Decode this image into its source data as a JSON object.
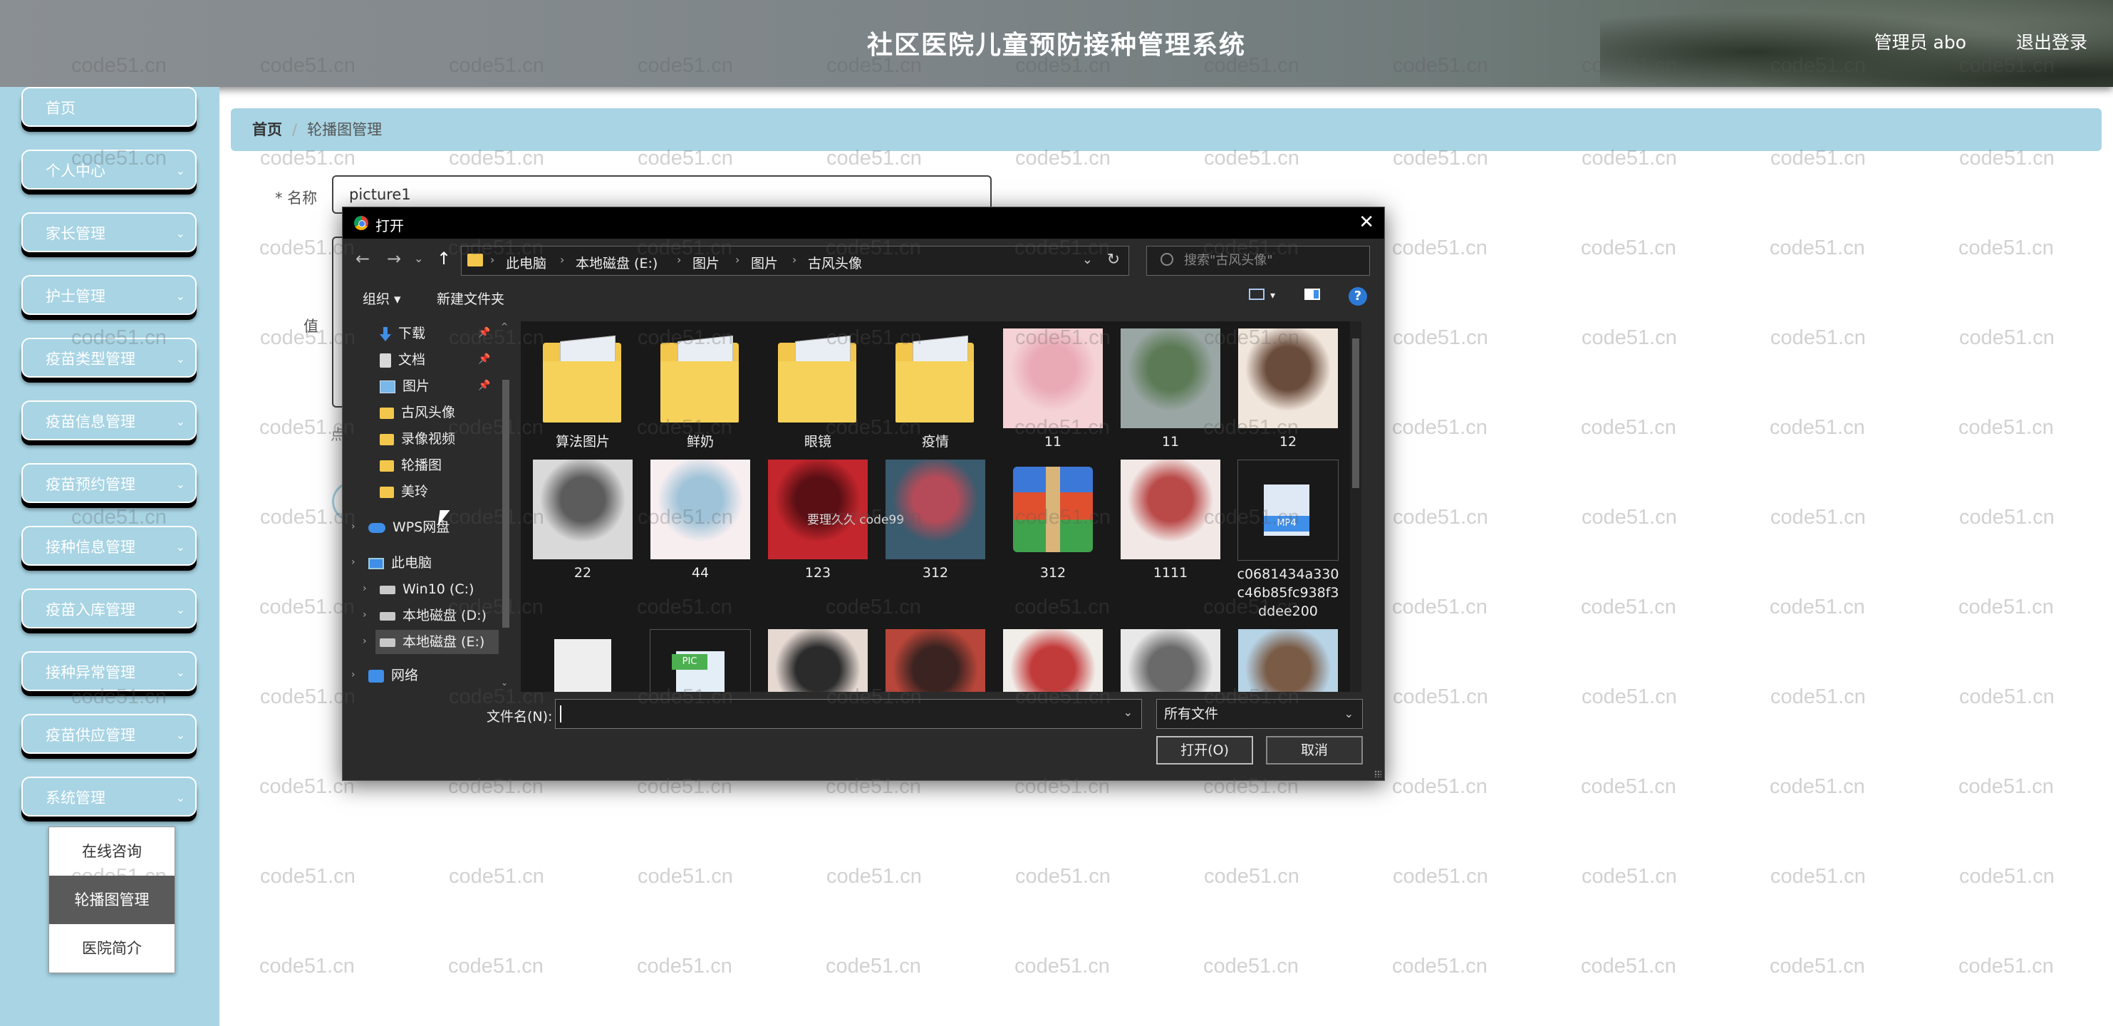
{
  "header": {
    "title": "社区医院儿童预防接种管理系统",
    "user": "管理员 abo",
    "logout": "退出登录"
  },
  "sidebar": {
    "items": [
      {
        "label": "首页"
      },
      {
        "label": "个人中心"
      },
      {
        "label": "家长管理"
      },
      {
        "label": "护士管理"
      },
      {
        "label": "疫苗类型管理"
      },
      {
        "label": "疫苗信息管理"
      },
      {
        "label": "疫苗预约管理"
      },
      {
        "label": "接种信息管理"
      },
      {
        "label": "疫苗入库管理"
      },
      {
        "label": "接种异常管理"
      },
      {
        "label": "疫苗供应管理"
      },
      {
        "label": "系统管理"
      }
    ],
    "chevron": "⌄",
    "submenu": [
      "在线咨询",
      "轮播图管理",
      "医院简介"
    ]
  },
  "breadcrumb": {
    "home": "首页",
    "sep": "/",
    "current": "轮播图管理"
  },
  "form": {
    "name_label": "* 名称",
    "name_value": "picture1",
    "value_label": "值",
    "hint_char": "点"
  },
  "watermark": "code51.cn",
  "dialog": {
    "title": "打开",
    "close": "✕",
    "nav": {
      "back": "←",
      "forward": "→",
      "recent": "⌄",
      "up": "↑"
    },
    "address": [
      "此电脑",
      "本地磁盘 (E:)",
      "图片",
      "图片",
      "古风头像"
    ],
    "address_sep": "›",
    "address_dropdown": "⌄",
    "refresh": "↻",
    "search_placeholder": "搜索\"古风头像\"",
    "toolbar": {
      "organize": "组织 ▾",
      "new_folder": "新建文件夹",
      "view_menu": "▾",
      "help": "?"
    },
    "tree": [
      {
        "label": "下载",
        "icon": "download-icon",
        "pinned": true
      },
      {
        "label": "文档",
        "icon": "document-icon",
        "pinned": true
      },
      {
        "label": "图片",
        "icon": "pictures-icon",
        "pinned": true
      },
      {
        "label": "古风头像",
        "icon": "folder-icon",
        "pinned": false
      },
      {
        "label": "录像视频",
        "icon": "folder-icon",
        "pinned": false
      },
      {
        "label": "轮播图",
        "icon": "folder-icon",
        "pinned": false
      },
      {
        "label": "美玲",
        "icon": "folder-icon",
        "pinned": false
      },
      {
        "label": "WPS网盘",
        "icon": "cloud-icon",
        "pinned": false
      },
      {
        "label": "此电脑",
        "icon": "computer-icon",
        "pinned": false
      },
      {
        "label": "Win10 (C:)",
        "icon": "drive-icon",
        "pinned": false
      },
      {
        "label": "本地磁盘 (D:)",
        "icon": "drive-icon",
        "pinned": false
      },
      {
        "label": "本地磁盘 (E:)",
        "icon": "drive-icon",
        "pinned": false
      },
      {
        "label": "网络",
        "icon": "network-icon",
        "pinned": false
      }
    ],
    "pin_glyph": "📌",
    "expand_glyph": "›",
    "scroll_up": "^",
    "scroll_down": "⌄",
    "files": [
      {
        "label": "算法图片",
        "kind": "folder"
      },
      {
        "label": "鲜奶",
        "kind": "folder"
      },
      {
        "label": "眼镜",
        "kind": "folder"
      },
      {
        "label": "疫情",
        "kind": "folder"
      },
      {
        "label": "11",
        "kind": "image",
        "colors": [
          "#f4d2d6",
          "#e9a9b5"
        ]
      },
      {
        "label": "11",
        "kind": "image",
        "colors": [
          "#9aa6a4",
          "#5b7a55"
        ]
      },
      {
        "label": "12",
        "kind": "image",
        "colors": [
          "#f1e6dc",
          "#6a4c3c"
        ]
      },
      {
        "label": "22",
        "kind": "image",
        "colors": [
          "#d9d9d9",
          "#5c5c5c"
        ]
      },
      {
        "label": "44",
        "kind": "image",
        "colors": [
          "#f7eef0",
          "#9fc3d8"
        ]
      },
      {
        "label": "123",
        "kind": "image",
        "colors": [
          "#c3262c",
          "#5a0f14"
        ]
      },
      {
        "label": "312",
        "kind": "image",
        "colors": [
          "#3b5b6e",
          "#b54b58"
        ]
      },
      {
        "label": "312",
        "kind": "archive"
      },
      {
        "label": "1111",
        "kind": "image",
        "colors": [
          "#f2e8e6",
          "#b94a48"
        ]
      },
      {
        "label": "c0681434a330c46b85fc938f3ddee200",
        "kind": "video",
        "badge": "MP4"
      },
      {
        "label": "",
        "kind": "document"
      },
      {
        "label": "",
        "kind": "picfile",
        "badge": "PIC"
      },
      {
        "label": "",
        "kind": "image",
        "colors": [
          "#e6d9d2",
          "#2b2b2b"
        ]
      },
      {
        "label": "",
        "kind": "image",
        "colors": [
          "#b8463a",
          "#3a2320"
        ]
      },
      {
        "label": "",
        "kind": "image",
        "colors": [
          "#f1ede8",
          "#c23b3b"
        ]
      },
      {
        "label": "",
        "kind": "image",
        "colors": [
          "#e8e8e8",
          "#6a6a6a"
        ]
      },
      {
        "label": "",
        "kind": "image",
        "colors": [
          "#b7d3e6",
          "#7a5b46"
        ]
      }
    ],
    "overlay_text": "要理久久 code99",
    "filename_label": "文件名(N):",
    "filename_value": "",
    "filename_dropdown": "⌄",
    "filetype": "所有文件",
    "filetype_dropdown": "⌄",
    "open_button": "打开(O)",
    "cancel_button": "取消"
  },
  "colors": {
    "sidebar_bg": "#a8d4e4",
    "dialog_bg": "#2b2b2b",
    "folder": "#f3c74b"
  }
}
